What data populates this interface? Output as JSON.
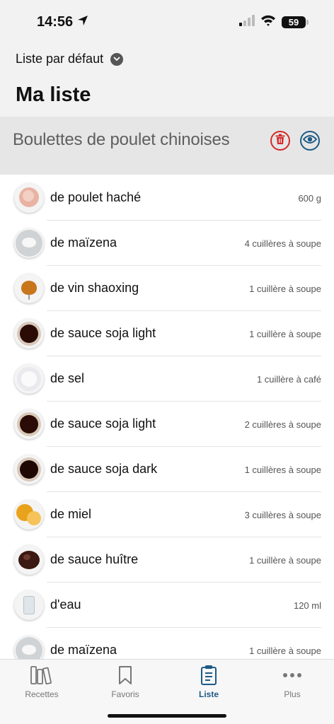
{
  "status": {
    "time": "14:56",
    "battery": "59"
  },
  "header": {
    "list_selector": "Liste par défaut",
    "title": "Ma liste"
  },
  "recipe": {
    "title": "Boulettes de poulet chinoises"
  },
  "ingredients": [
    {
      "name": "de poulet haché",
      "qty": "600 g",
      "icon": "chicken-icon"
    },
    {
      "name": "de maïzena",
      "qty": "4 cuillères à soupe",
      "icon": "cornstarch-icon"
    },
    {
      "name": "de vin shaoxing",
      "qty": "1 cuillère à soupe",
      "icon": "wine-glass-icon"
    },
    {
      "name": "de sauce soja light",
      "qty": "1 cuillère à soupe",
      "icon": "soy-sauce-icon"
    },
    {
      "name": "de sel",
      "qty": "1 cuillère à café",
      "icon": "salt-icon"
    },
    {
      "name": "de sauce soja light",
      "qty": "2 cuillères à soupe",
      "icon": "soy-sauce-icon"
    },
    {
      "name": "de sauce soja dark",
      "qty": "1 cuillères à soupe",
      "icon": "soy-sauce-icon"
    },
    {
      "name": "de miel",
      "qty": "3 cuillères à soupe",
      "icon": "honey-icon"
    },
    {
      "name": "de sauce huître",
      "qty": "1 cuillère à soupe",
      "icon": "oyster-sauce-icon"
    },
    {
      "name": "d'eau",
      "qty": "120 ml",
      "icon": "water-glass-icon"
    },
    {
      "name": "de maïzena",
      "qty": "1 cuillère à soupe",
      "icon": "cornstarch-icon"
    }
  ],
  "tabs": [
    {
      "label": "Recettes",
      "icon": "books-icon"
    },
    {
      "label": "Favoris",
      "icon": "bookmark-icon"
    },
    {
      "label": "Liste",
      "icon": "clipboard-icon"
    },
    {
      "label": "Plus",
      "icon": "more-icon"
    }
  ],
  "colors": {
    "accent": "#1e5a86",
    "delete": "#d42a2a",
    "header_bg": "#f2f2f2",
    "recipe_bar_bg": "#e6e6e6"
  }
}
